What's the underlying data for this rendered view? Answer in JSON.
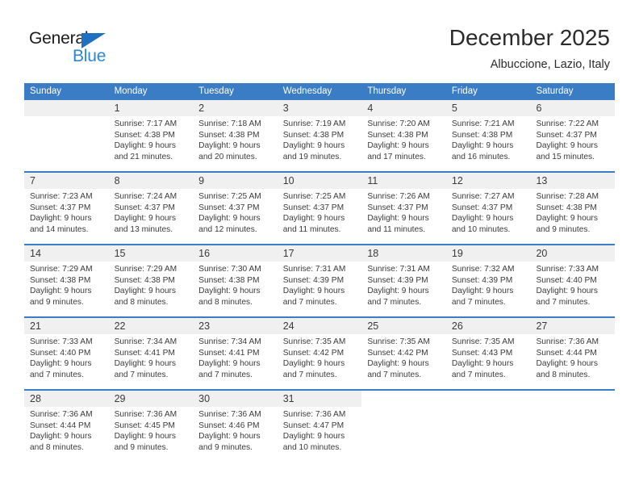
{
  "logo": {
    "text_top": "General",
    "text_bottom": "Blue",
    "triangle_color": "#1f70c1",
    "blue_color": "#2e86d6"
  },
  "header": {
    "title": "December 2025",
    "subtitle": "Albuccione, Lazio, Italy"
  },
  "calendar": {
    "header_bg": "#3b7dc4",
    "day_band_bg": "#f0f0f0",
    "weekday_headers": [
      "Sunday",
      "Monday",
      "Tuesday",
      "Wednesday",
      "Thursday",
      "Friday",
      "Saturday"
    ],
    "weeks": [
      [
        {
          "day": "",
          "sunrise": "",
          "sunset": "",
          "daylight_line1": "",
          "daylight_line2": "",
          "empty": true
        },
        {
          "day": "1",
          "sunrise": "Sunrise: 7:17 AM",
          "sunset": "Sunset: 4:38 PM",
          "daylight_line1": "Daylight: 9 hours",
          "daylight_line2": "and 21 minutes."
        },
        {
          "day": "2",
          "sunrise": "Sunrise: 7:18 AM",
          "sunset": "Sunset: 4:38 PM",
          "daylight_line1": "Daylight: 9 hours",
          "daylight_line2": "and 20 minutes."
        },
        {
          "day": "3",
          "sunrise": "Sunrise: 7:19 AM",
          "sunset": "Sunset: 4:38 PM",
          "daylight_line1": "Daylight: 9 hours",
          "daylight_line2": "and 19 minutes."
        },
        {
          "day": "4",
          "sunrise": "Sunrise: 7:20 AM",
          "sunset": "Sunset: 4:38 PM",
          "daylight_line1": "Daylight: 9 hours",
          "daylight_line2": "and 17 minutes."
        },
        {
          "day": "5",
          "sunrise": "Sunrise: 7:21 AM",
          "sunset": "Sunset: 4:38 PM",
          "daylight_line1": "Daylight: 9 hours",
          "daylight_line2": "and 16 minutes."
        },
        {
          "day": "6",
          "sunrise": "Sunrise: 7:22 AM",
          "sunset": "Sunset: 4:37 PM",
          "daylight_line1": "Daylight: 9 hours",
          "daylight_line2": "and 15 minutes."
        }
      ],
      [
        {
          "day": "7",
          "sunrise": "Sunrise: 7:23 AM",
          "sunset": "Sunset: 4:37 PM",
          "daylight_line1": "Daylight: 9 hours",
          "daylight_line2": "and 14 minutes."
        },
        {
          "day": "8",
          "sunrise": "Sunrise: 7:24 AM",
          "sunset": "Sunset: 4:37 PM",
          "daylight_line1": "Daylight: 9 hours",
          "daylight_line2": "and 13 minutes."
        },
        {
          "day": "9",
          "sunrise": "Sunrise: 7:25 AM",
          "sunset": "Sunset: 4:37 PM",
          "daylight_line1": "Daylight: 9 hours",
          "daylight_line2": "and 12 minutes."
        },
        {
          "day": "10",
          "sunrise": "Sunrise: 7:25 AM",
          "sunset": "Sunset: 4:37 PM",
          "daylight_line1": "Daylight: 9 hours",
          "daylight_line2": "and 11 minutes."
        },
        {
          "day": "11",
          "sunrise": "Sunrise: 7:26 AM",
          "sunset": "Sunset: 4:37 PM",
          "daylight_line1": "Daylight: 9 hours",
          "daylight_line2": "and 11 minutes."
        },
        {
          "day": "12",
          "sunrise": "Sunrise: 7:27 AM",
          "sunset": "Sunset: 4:37 PM",
          "daylight_line1": "Daylight: 9 hours",
          "daylight_line2": "and 10 minutes."
        },
        {
          "day": "13",
          "sunrise": "Sunrise: 7:28 AM",
          "sunset": "Sunset: 4:38 PM",
          "daylight_line1": "Daylight: 9 hours",
          "daylight_line2": "and 9 minutes."
        }
      ],
      [
        {
          "day": "14",
          "sunrise": "Sunrise: 7:29 AM",
          "sunset": "Sunset: 4:38 PM",
          "daylight_line1": "Daylight: 9 hours",
          "daylight_line2": "and 9 minutes."
        },
        {
          "day": "15",
          "sunrise": "Sunrise: 7:29 AM",
          "sunset": "Sunset: 4:38 PM",
          "daylight_line1": "Daylight: 9 hours",
          "daylight_line2": "and 8 minutes."
        },
        {
          "day": "16",
          "sunrise": "Sunrise: 7:30 AM",
          "sunset": "Sunset: 4:38 PM",
          "daylight_line1": "Daylight: 9 hours",
          "daylight_line2": "and 8 minutes."
        },
        {
          "day": "17",
          "sunrise": "Sunrise: 7:31 AM",
          "sunset": "Sunset: 4:39 PM",
          "daylight_line1": "Daylight: 9 hours",
          "daylight_line2": "and 7 minutes."
        },
        {
          "day": "18",
          "sunrise": "Sunrise: 7:31 AM",
          "sunset": "Sunset: 4:39 PM",
          "daylight_line1": "Daylight: 9 hours",
          "daylight_line2": "and 7 minutes."
        },
        {
          "day": "19",
          "sunrise": "Sunrise: 7:32 AM",
          "sunset": "Sunset: 4:39 PM",
          "daylight_line1": "Daylight: 9 hours",
          "daylight_line2": "and 7 minutes."
        },
        {
          "day": "20",
          "sunrise": "Sunrise: 7:33 AM",
          "sunset": "Sunset: 4:40 PM",
          "daylight_line1": "Daylight: 9 hours",
          "daylight_line2": "and 7 minutes."
        }
      ],
      [
        {
          "day": "21",
          "sunrise": "Sunrise: 7:33 AM",
          "sunset": "Sunset: 4:40 PM",
          "daylight_line1": "Daylight: 9 hours",
          "daylight_line2": "and 7 minutes."
        },
        {
          "day": "22",
          "sunrise": "Sunrise: 7:34 AM",
          "sunset": "Sunset: 4:41 PM",
          "daylight_line1": "Daylight: 9 hours",
          "daylight_line2": "and 7 minutes."
        },
        {
          "day": "23",
          "sunrise": "Sunrise: 7:34 AM",
          "sunset": "Sunset: 4:41 PM",
          "daylight_line1": "Daylight: 9 hours",
          "daylight_line2": "and 7 minutes."
        },
        {
          "day": "24",
          "sunrise": "Sunrise: 7:35 AM",
          "sunset": "Sunset: 4:42 PM",
          "daylight_line1": "Daylight: 9 hours",
          "daylight_line2": "and 7 minutes."
        },
        {
          "day": "25",
          "sunrise": "Sunrise: 7:35 AM",
          "sunset": "Sunset: 4:42 PM",
          "daylight_line1": "Daylight: 9 hours",
          "daylight_line2": "and 7 minutes."
        },
        {
          "day": "26",
          "sunrise": "Sunrise: 7:35 AM",
          "sunset": "Sunset: 4:43 PM",
          "daylight_line1": "Daylight: 9 hours",
          "daylight_line2": "and 7 minutes."
        },
        {
          "day": "27",
          "sunrise": "Sunrise: 7:36 AM",
          "sunset": "Sunset: 4:44 PM",
          "daylight_line1": "Daylight: 9 hours",
          "daylight_line2": "and 8 minutes."
        }
      ],
      [
        {
          "day": "28",
          "sunrise": "Sunrise: 7:36 AM",
          "sunset": "Sunset: 4:44 PM",
          "daylight_line1": "Daylight: 9 hours",
          "daylight_line2": "and 8 minutes."
        },
        {
          "day": "29",
          "sunrise": "Sunrise: 7:36 AM",
          "sunset": "Sunset: 4:45 PM",
          "daylight_line1": "Daylight: 9 hours",
          "daylight_line2": "and 9 minutes."
        },
        {
          "day": "30",
          "sunrise": "Sunrise: 7:36 AM",
          "sunset": "Sunset: 4:46 PM",
          "daylight_line1": "Daylight: 9 hours",
          "daylight_line2": "and 9 minutes."
        },
        {
          "day": "31",
          "sunrise": "Sunrise: 7:36 AM",
          "sunset": "Sunset: 4:47 PM",
          "daylight_line1": "Daylight: 9 hours",
          "daylight_line2": "and 10 minutes."
        },
        {
          "day": "",
          "sunrise": "",
          "sunset": "",
          "daylight_line1": "",
          "daylight_line2": "",
          "blank": true
        },
        {
          "day": "",
          "sunrise": "",
          "sunset": "",
          "daylight_line1": "",
          "daylight_line2": "",
          "blank": true
        },
        {
          "day": "",
          "sunrise": "",
          "sunset": "",
          "daylight_line1": "",
          "daylight_line2": "",
          "blank": true
        }
      ]
    ]
  }
}
